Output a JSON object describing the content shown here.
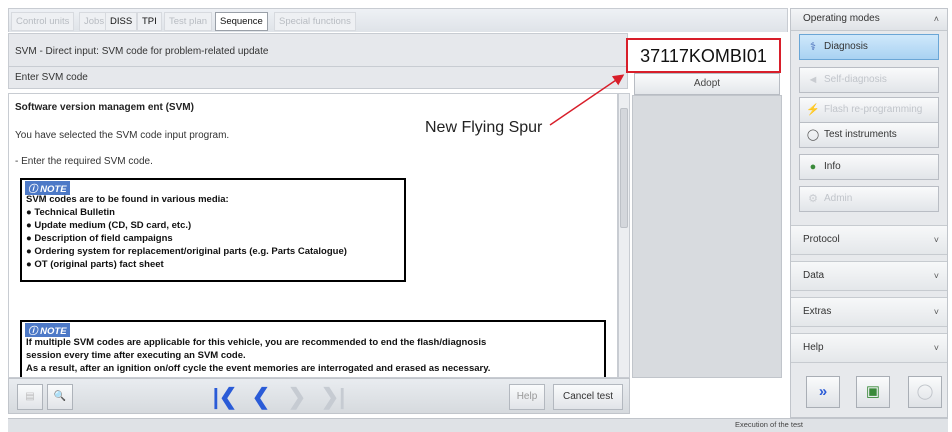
{
  "tabs": [
    {
      "label": "Control units",
      "state": "disabled"
    },
    {
      "label": "Jobs",
      "state": "disabled"
    },
    {
      "label": "DISS",
      "state": "normal"
    },
    {
      "label": "TPI",
      "state": "normal"
    },
    {
      "label": "Test plan",
      "state": "disabled"
    },
    {
      "label": "Sequence",
      "state": "active"
    },
    {
      "label": "Special functions",
      "state": "disabled"
    }
  ],
  "header": {
    "title": "SVM - Direct input: SVM code for problem-related update",
    "subtitle": "Enter SVM code"
  },
  "svm_code": "37117KOMBI01",
  "adopt_label": "Adopt",
  "annotation": "New Flying Spur",
  "content": {
    "title": "Software version managem ent (SVM)",
    "line1": "You have selected the SVM code input program.",
    "line2": "- Enter the required SVM code.",
    "note1": {
      "label": "NOTE",
      "heading": "SVM codes are to be found in various media:",
      "items": [
        "Technical Bulletin",
        "Update medium (CD, SD card, etc.)",
        "Description of field campaigns",
        "Ordering system for replacement/original parts (e.g. Parts Catalogue)",
        "OT (original parts) fact sheet"
      ]
    },
    "note2": {
      "label": "NOTE",
      "lines": [
        "If multiple SVM codes are applicable for this vehicle, you are recommended to end the flash/diagnosis",
        "session every time after executing an SVM code.",
        "As a result, after an ignition on/off cycle the event memories are interrogated and erased as necessary."
      ]
    }
  },
  "toolbar": {
    "help_label": "Help",
    "cancel_label": "Cancel test"
  },
  "right_panel": {
    "modes_title": "Operating modes",
    "buttons": [
      {
        "label": "Diagnosis",
        "icon": "stethoscope-icon",
        "state": "active"
      },
      {
        "label": "Self-diagnosis",
        "icon": "car-icon",
        "state": "disabled"
      },
      {
        "label": "Flash re-programming",
        "icon": "flash-icon",
        "state": "disabled"
      },
      {
        "label": "Test instruments",
        "icon": "multimeter-icon",
        "state": "normal"
      },
      {
        "label": "Info",
        "icon": "info-icon",
        "state": "normal"
      },
      {
        "label": "Admin",
        "icon": "admin-icon",
        "state": "disabled"
      }
    ],
    "sections": [
      "Protocol",
      "Data",
      "Extras",
      "Help"
    ]
  },
  "status": "Execution of the test",
  "colors": {
    "highlight": "#d81e2a",
    "active_blue": "#a9d2f2",
    "note_blue": "#4d79c7",
    "nav_blue": "#2a5bd7"
  }
}
